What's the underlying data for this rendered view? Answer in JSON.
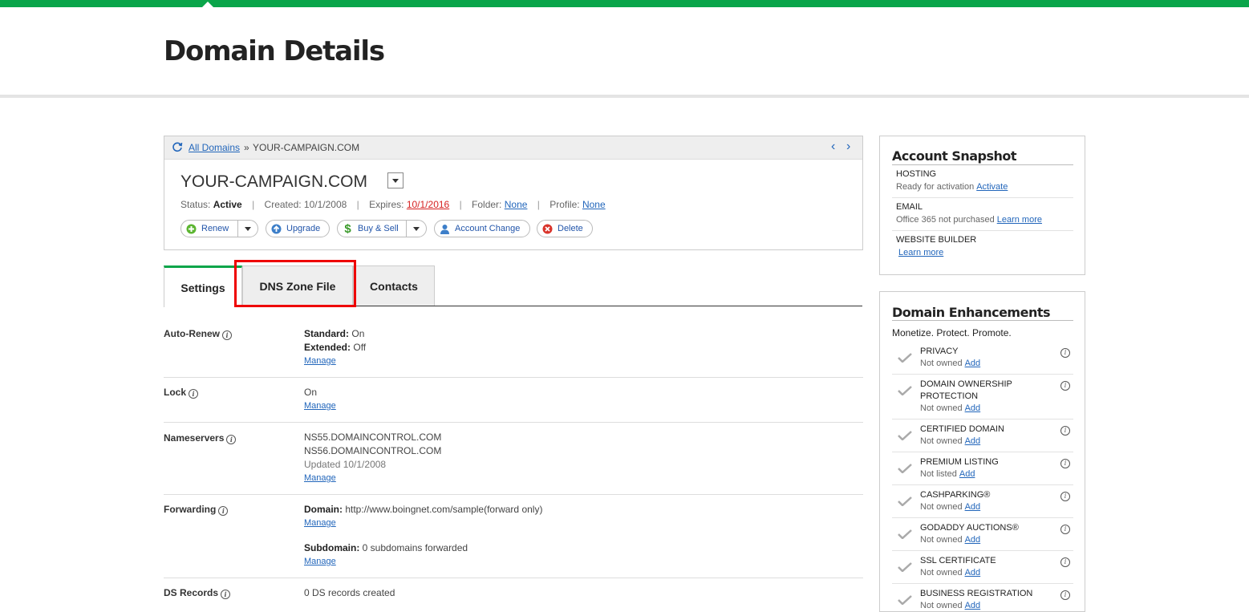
{
  "header": {
    "title": "Domain Details"
  },
  "breadcrumb": {
    "all_domains": "All Domains",
    "separator": "»",
    "current": "YOUR-CAMPAIGN.COM"
  },
  "domain": {
    "name": "YOUR-CAMPAIGN.COM",
    "status_label": "Status:",
    "status": "Active",
    "created_label": "Created:",
    "created": "10/1/2008",
    "expires_label": "Expires:",
    "expires": "10/1/2016",
    "folder_label": "Folder:",
    "folder": "None",
    "profile_label": "Profile:",
    "profile": "None"
  },
  "actions": {
    "renew": "Renew",
    "upgrade": "Upgrade",
    "buy_sell": "Buy & Sell",
    "account_change": "Account Change",
    "delete": "Delete"
  },
  "tabs": {
    "settings": "Settings",
    "dns": "DNS Zone File",
    "contacts": "Contacts"
  },
  "settings": {
    "manage": "Manage",
    "autorenew": {
      "label": "Auto-Renew",
      "standard_label": "Standard:",
      "standard": "On",
      "extended_label": "Extended:",
      "extended": "Off"
    },
    "lock": {
      "label": "Lock",
      "value": "On"
    },
    "nameservers": {
      "label": "Nameservers",
      "ns1": "NS55.DOMAINCONTROL.COM",
      "ns2": "NS56.DOMAINCONTROL.COM",
      "updated": "Updated 10/1/2008"
    },
    "forwarding": {
      "label": "Forwarding",
      "domain_label": "Domain:",
      "domain_value": "http://www.boingnet.com/sample(forward only)",
      "subdomain_label": "Subdomain:",
      "subdomain_value": "0 subdomains forwarded"
    },
    "ds": {
      "label": "DS Records",
      "value": "0 DS records created"
    }
  },
  "snapshot": {
    "title": "Account Snapshot",
    "hosting": {
      "title": "HOSTING",
      "sub": "Ready for activation",
      "link": "Activate"
    },
    "email": {
      "title": "EMAIL",
      "sub": "Office 365 not purchased",
      "link": "Learn more"
    },
    "builder": {
      "title": "WEBSITE BUILDER",
      "link": "Learn more"
    }
  },
  "enhancements": {
    "title": "Domain Enhancements",
    "tagline": "Monetize. Protect. Promote.",
    "add": "Add",
    "items": [
      {
        "title": "PRIVACY",
        "status": "Not owned"
      },
      {
        "title": "DOMAIN OWNERSHIP PROTECTION",
        "status": "Not owned"
      },
      {
        "title": "CERTIFIED DOMAIN",
        "status": "Not owned"
      },
      {
        "title": "PREMIUM LISTING",
        "status": "Not listed"
      },
      {
        "title": "CASHPARKING®",
        "status": "Not owned"
      },
      {
        "title": "GODADDY AUCTIONS®",
        "status": "Not owned"
      },
      {
        "title": "SSL CERTIFICATE",
        "status": "Not owned"
      },
      {
        "title": "BUSINESS REGISTRATION",
        "status": "Not owned"
      }
    ]
  },
  "colors": {
    "brand_green": "#0aa54a",
    "link_blue": "#2266bb",
    "expire_red": "#d62222",
    "highlight_red": "#ee0000"
  }
}
